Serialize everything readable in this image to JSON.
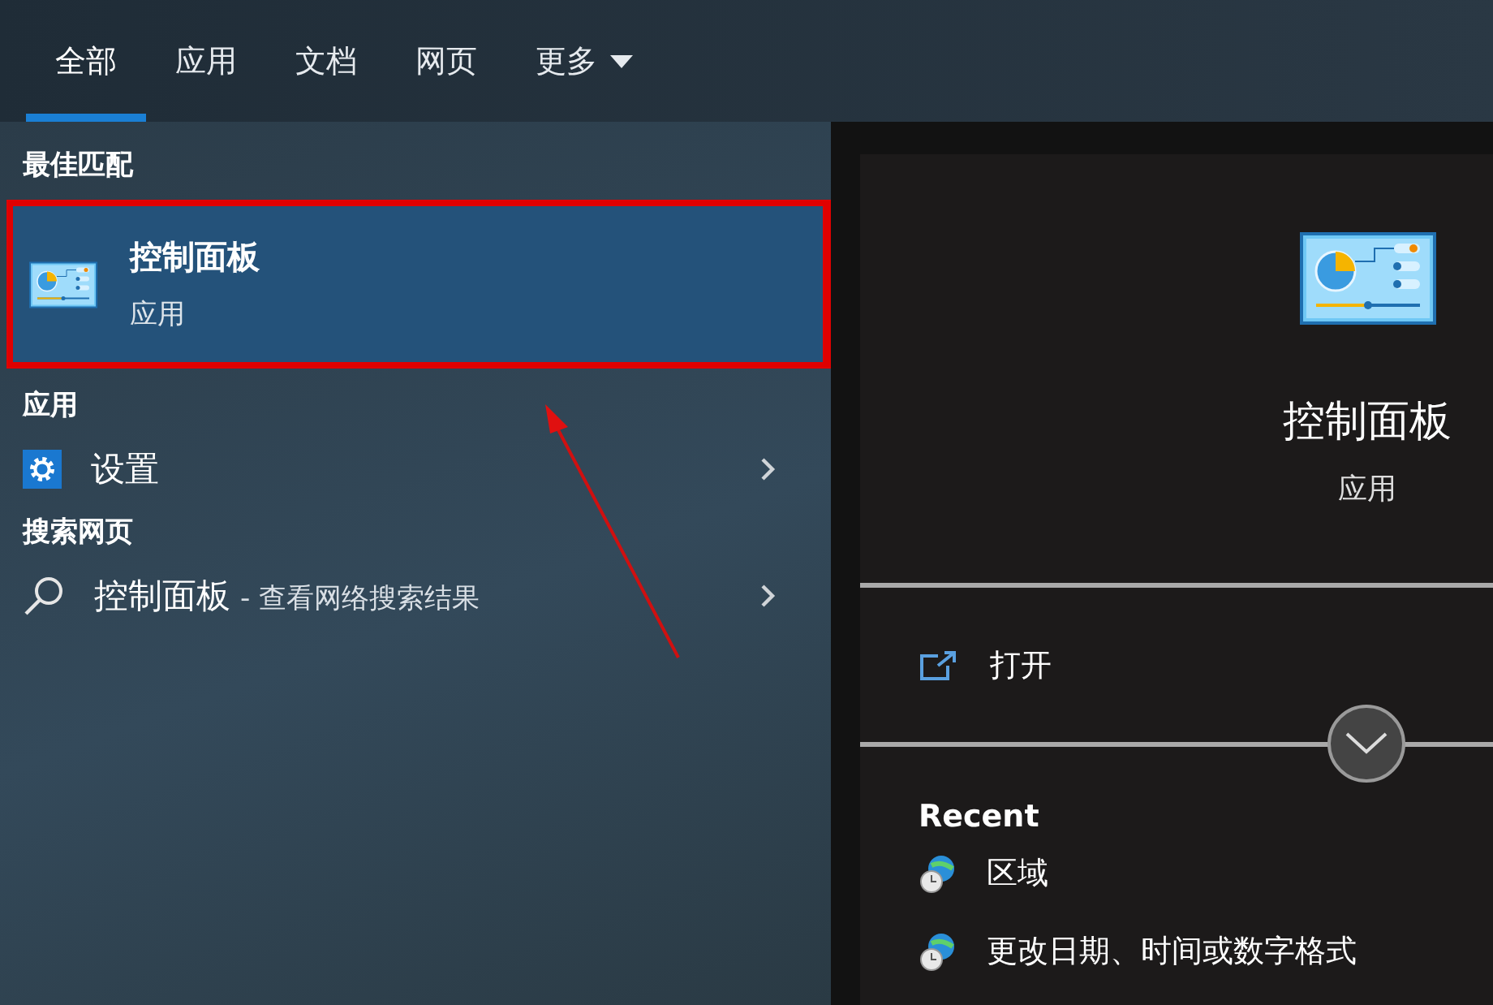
{
  "tabs": [
    {
      "label": "全部",
      "selected": true,
      "has_menu": false
    },
    {
      "label": "应用",
      "selected": false,
      "has_menu": false
    },
    {
      "label": "文档",
      "selected": false,
      "has_menu": false
    },
    {
      "label": "网页",
      "selected": false,
      "has_menu": false
    },
    {
      "label": "更多",
      "selected": false,
      "has_menu": true
    }
  ],
  "best_match": {
    "heading": "最佳匹配",
    "item": {
      "title": "控制面板",
      "subtitle": "应用",
      "selected": true
    }
  },
  "apps": {
    "heading": "应用",
    "items": [
      {
        "label": "设置"
      }
    ]
  },
  "web": {
    "heading": "搜索网页",
    "items": [
      {
        "query": "控制面板",
        "suffix": "- 查看网络搜索结果"
      }
    ]
  },
  "detail": {
    "title": "控制面板",
    "subtitle": "应用",
    "actions": [
      {
        "label": "打开"
      }
    ],
    "recent_heading": "Recent",
    "recent": [
      {
        "label": "区域"
      },
      {
        "label": "更改日期、时间或数字格式"
      }
    ]
  }
}
